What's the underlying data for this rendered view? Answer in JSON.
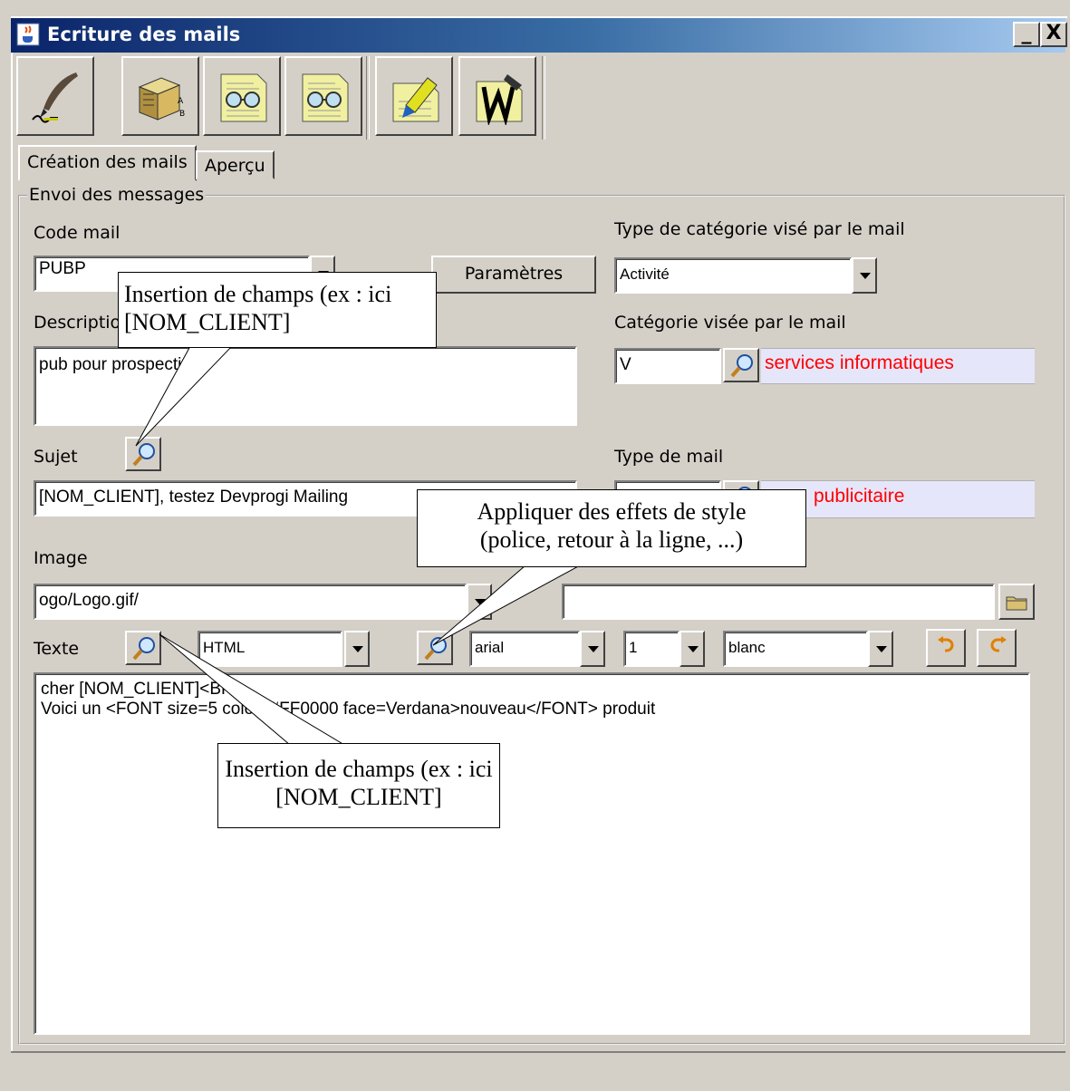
{
  "window": {
    "title": "Ecriture des mails",
    "minimize_label": "_",
    "close_label": "X"
  },
  "toolbar": {
    "buttons": [
      {
        "icon": "quill-pen-icon"
      },
      {
        "icon": "stamped-parcel-icon"
      },
      {
        "icon": "preview-glasses-icon"
      },
      {
        "icon": "preview-glasses-alt-icon"
      },
      {
        "icon": "highlighter-icon"
      },
      {
        "icon": "sign-document-icon"
      }
    ]
  },
  "tabs": [
    {
      "label": "Création des mails",
      "active": true
    },
    {
      "label": "Aperçu",
      "active": false
    }
  ],
  "group": {
    "legend": "Envoi des messages"
  },
  "form": {
    "code_mail": {
      "label": "Code mail",
      "value": "PUBP"
    },
    "parametres_button": "Paramètres",
    "type_categorie": {
      "label": "Type de catégorie visé par le mail",
      "value": "Activité"
    },
    "description": {
      "label": "Description",
      "value": "pub pour prospection"
    },
    "categorie": {
      "label": "Catégorie visée par le mail",
      "code": "V",
      "name": "services informatiques"
    },
    "sujet": {
      "label": "Sujet",
      "value": "[NOM_CLIENT], testez Devprogi Mailing"
    },
    "type_mail": {
      "label": "Type de mail",
      "name": "publicitaire"
    },
    "image": {
      "label": "Image",
      "value": "ogo/Logo.gif/",
      "path": ""
    },
    "texte": {
      "label": "Texte",
      "format": "HTML",
      "font": "arial",
      "size": "1",
      "color": "blanc",
      "content": "cher [NOM_CLIENT]<BR>\nVoici un <FONT size=5 color=#FF0000 face=Verdana>nouveau</FONT> produit"
    }
  },
  "callouts": {
    "insertion_1": "Insertion de champs (ex : ici [NOM_CLIENT]",
    "style": "Appliquer des effets de style (police, retour à la ligne, ...)",
    "insertion_2": "Insertion de champs (ex : ici [NOM_CLIENT]"
  },
  "colors": {
    "titlebar_start": "#0a246a",
    "titlebar_end": "#a6caf0",
    "highlight_field": "#e6e6fa",
    "highlight_text": "#ff0000"
  }
}
